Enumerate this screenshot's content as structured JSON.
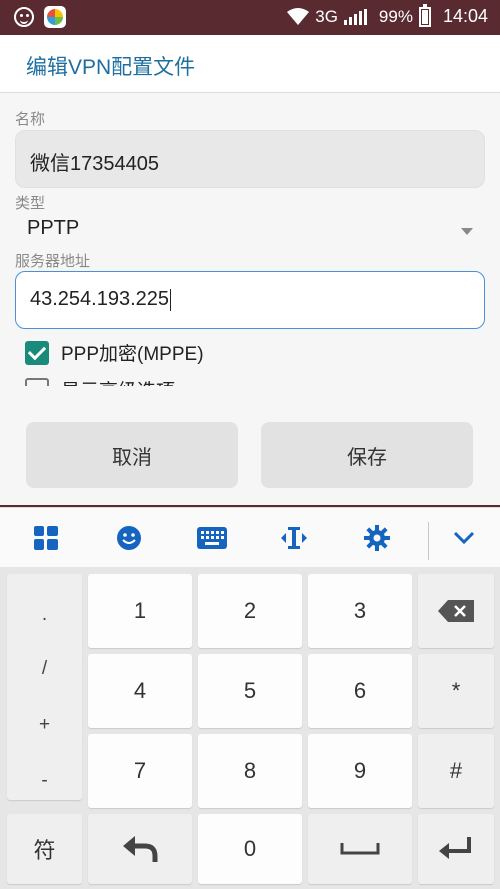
{
  "status_bar": {
    "network": "3G",
    "battery": "99%",
    "time": "14:04"
  },
  "dialog": {
    "title": "编辑VPN配置文件",
    "name_label": "名称",
    "name_value": "微信17354405",
    "type_label": "类型",
    "type_value": "PPTP",
    "server_label": "服务器地址",
    "server_value": "43.254.193.225",
    "encrypt_label": "PPP加密(MPPE)",
    "encrypt_checked": true,
    "advanced_label": "显示高级选项",
    "cancel_label": "取消",
    "save_label": "保存"
  },
  "toolbar": {
    "icons": [
      "grid-icon",
      "emoji-icon",
      "keyboard-icon",
      "cursor-icon",
      "settings-icon",
      "chevron-down-icon"
    ],
    "accent": "#1565c0"
  },
  "keypad": {
    "symbols": [
      ".",
      "/",
      "+",
      "-"
    ],
    "digits": [
      "1",
      "2",
      "3",
      "4",
      "5",
      "6",
      "7",
      "8",
      "9",
      "0"
    ],
    "star": "*",
    "hash": "#",
    "fu_label": "符"
  }
}
